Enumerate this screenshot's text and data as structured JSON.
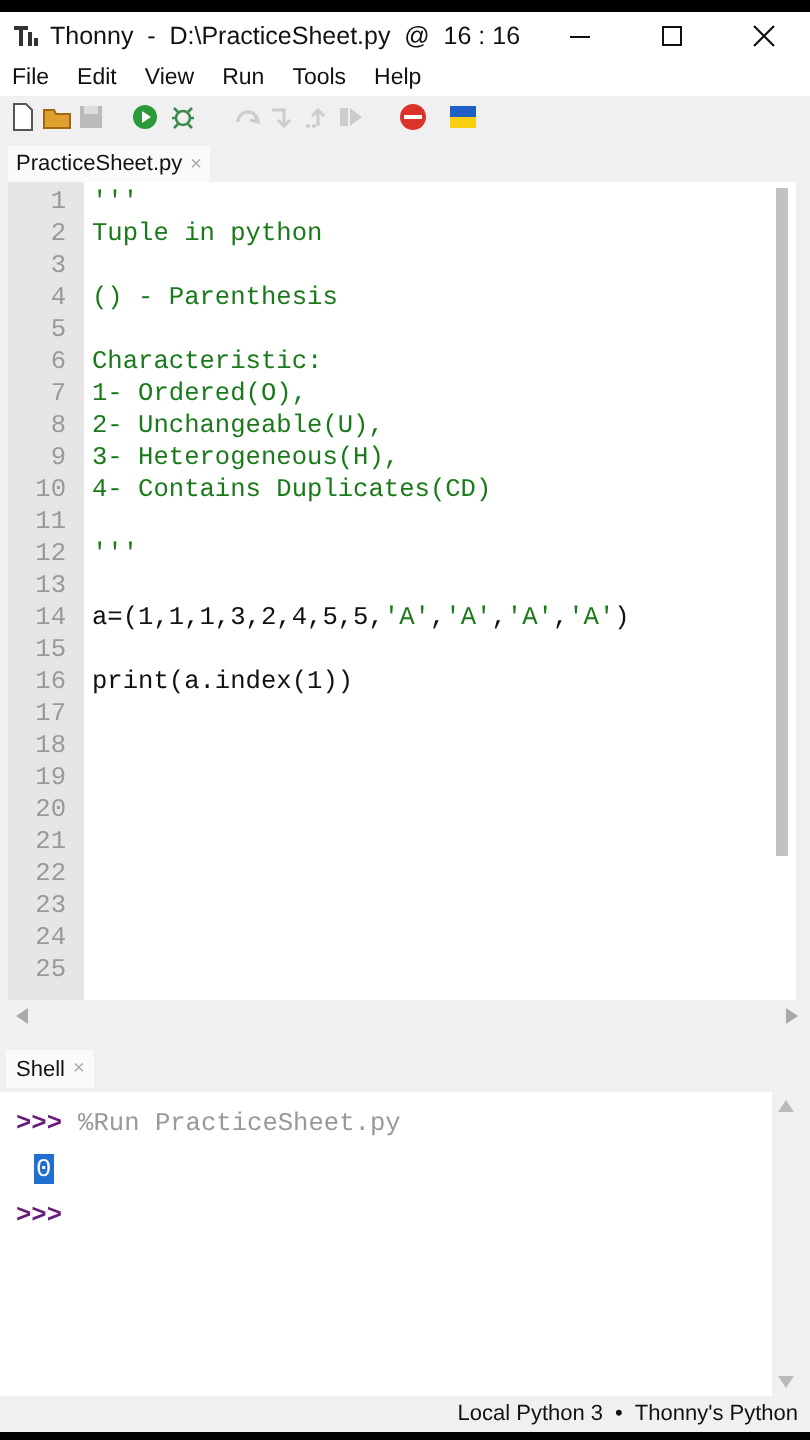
{
  "window": {
    "title": "Thonny  -  D:\\PracticeSheet.py  @  16 : 16"
  },
  "menu": [
    "File",
    "Edit",
    "View",
    "Run",
    "Tools",
    "Help"
  ],
  "toolbar": [
    {
      "kind": "new",
      "disabled": false
    },
    {
      "kind": "open",
      "disabled": false
    },
    {
      "kind": "save",
      "disabled": true
    },
    {
      "kind": "run",
      "disabled": false
    },
    {
      "kind": "debug",
      "disabled": false
    },
    {
      "kind": "step-over",
      "disabled": true
    },
    {
      "kind": "step-into",
      "disabled": true
    },
    {
      "kind": "step-out",
      "disabled": true
    },
    {
      "kind": "resume",
      "disabled": true
    },
    {
      "kind": "stop",
      "disabled": false
    },
    {
      "kind": "flag",
      "disabled": false
    }
  ],
  "editor": {
    "tab": {
      "label": "PracticeSheet.py",
      "close": "×"
    },
    "lines": [
      {
        "number": "1",
        "segments": [
          {
            "text": "'''",
            "kind": "string"
          }
        ]
      },
      {
        "number": "2",
        "segments": [
          {
            "text": "Tuple in python",
            "kind": "string"
          }
        ]
      },
      {
        "number": "3"
      },
      {
        "number": "4",
        "segments": [
          {
            "text": "() - Parenthesis",
            "kind": "string"
          }
        ]
      },
      {
        "number": "5"
      },
      {
        "number": "6",
        "segments": [
          {
            "text": "Characteristic:",
            "kind": "string"
          }
        ]
      },
      {
        "number": "7",
        "segments": [
          {
            "text": "1- Ordered(O),",
            "kind": "string"
          }
        ]
      },
      {
        "number": "8",
        "segments": [
          {
            "text": "2- Unchangeable(U),",
            "kind": "string"
          }
        ]
      },
      {
        "number": "9",
        "segments": [
          {
            "text": "3- Heterogeneous(H),",
            "kind": "string"
          }
        ]
      },
      {
        "number": "10",
        "segments": [
          {
            "text": "4- Contains Duplicates(CD)",
            "kind": "string"
          }
        ]
      },
      {
        "number": "11"
      },
      {
        "number": "12",
        "segments": [
          {
            "text": "'''",
            "kind": "string"
          }
        ]
      },
      {
        "number": "13"
      },
      {
        "number": "14",
        "segments": [
          {
            "text": "a=(1,1,1,3,2,4,5,5,",
            "kind": "code"
          },
          {
            "text": "'A'",
            "kind": "string"
          },
          {
            "text": ",",
            "kind": "code"
          },
          {
            "text": "'A'",
            "kind": "string"
          },
          {
            "text": ",",
            "kind": "code"
          },
          {
            "text": "'A'",
            "kind": "string"
          },
          {
            "text": ",",
            "kind": "code"
          },
          {
            "text": "'A'",
            "kind": "string"
          },
          {
            "text": ")",
            "kind": "code"
          }
        ]
      },
      {
        "number": "15"
      },
      {
        "number": "16",
        "segments": [
          {
            "text": "print(a.index(1))",
            "kind": "code"
          }
        ]
      },
      {
        "number": "17"
      },
      {
        "number": "18"
      },
      {
        "number": "19"
      },
      {
        "number": "20"
      },
      {
        "number": "21"
      },
      {
        "number": "22"
      },
      {
        "number": "23"
      },
      {
        "number": "24"
      },
      {
        "number": "25"
      }
    ]
  },
  "shell": {
    "tab": {
      "label": "Shell",
      "close": "×"
    },
    "lines": [
      {
        "kind": "prompt",
        "prompt": ">>>",
        "command": "%Run PracticeSheet.py"
      },
      {
        "kind": "output",
        "text": "0",
        "selected": true
      },
      {
        "kind": "prompt",
        "prompt": ">>>"
      }
    ]
  },
  "status_bar": {
    "interpreter": "Local Python 3",
    "separator": "•",
    "environment": "Thonny's Python"
  }
}
